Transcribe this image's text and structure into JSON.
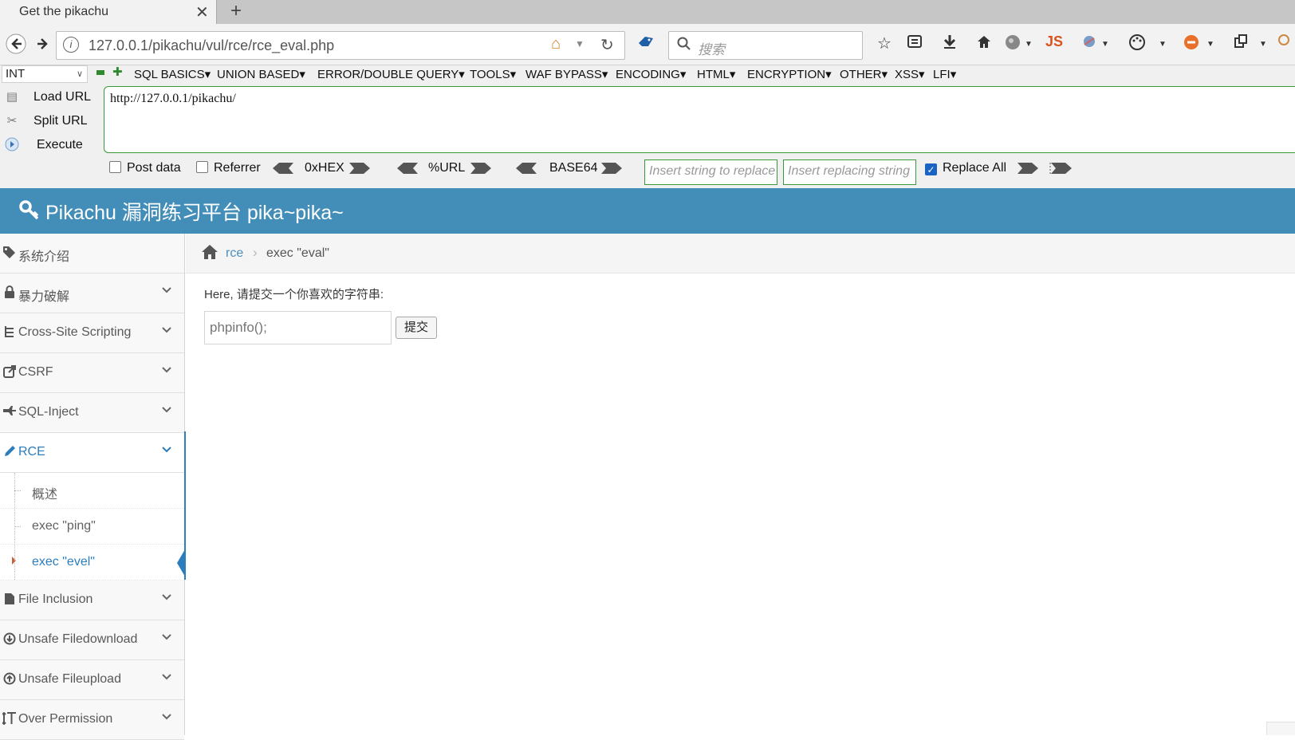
{
  "browser": {
    "tab_title": "Get the pikachu",
    "tab_close": "✕",
    "new_tab": "+",
    "url": "127.0.0.1/pikachu/vul/rce/rce_eval.php",
    "search_placeholder": "搜索"
  },
  "hackbar": {
    "encoding_select": "INT",
    "menus": [
      "SQL BASICS",
      "UNION BASED",
      "ERROR/DOUBLE QUERY",
      "TOOLS",
      "WAF BYPASS",
      "ENCODING",
      "HTML",
      "ENCRYPTION",
      "OTHER",
      "XSS",
      "LFI"
    ],
    "load_url": "Load URL",
    "split_url": "Split URL",
    "execute": "Execute",
    "url_value": "http://127.0.0.1/pikachu/",
    "post_data": "Post data",
    "referrer": "Referrer",
    "hex": "0xHEX",
    "urlenc": "%URL",
    "base64": "BASE64",
    "replace_placeholder": "Insert string to replace",
    "replacing_placeholder": "Insert replacing string",
    "replace_all": "Replace All",
    "replace_all_checked": true
  },
  "app": {
    "brand": "Pikachu 漏洞练习平台 pika~pika~",
    "header_color": "#438eb9",
    "accent_color": "#2b7dbc"
  },
  "sidebar": {
    "items": [
      {
        "label": "系统介绍",
        "icon": "tags-icon"
      },
      {
        "label": "暴力破解",
        "icon": "lock-icon"
      },
      {
        "label": "Cross-Site Scripting",
        "icon": "sitemap-icon"
      },
      {
        "label": "CSRF",
        "icon": "share-square-icon"
      },
      {
        "label": "SQL-Inject",
        "icon": "fighter-jet-icon"
      },
      {
        "label": "RCE",
        "icon": "pencil-icon"
      },
      {
        "label": "File Inclusion",
        "icon": "file-icon"
      },
      {
        "label": "Unsafe Filedownload",
        "icon": "download-circle-icon"
      },
      {
        "label": "Unsafe Fileupload",
        "icon": "upload-circle-icon"
      },
      {
        "label": "Over Permission",
        "icon": "text-height-icon"
      }
    ],
    "rce_sub": [
      "概述",
      "exec \"ping\"",
      "exec \"evel\""
    ]
  },
  "breadcrumb": {
    "link": "rce",
    "separator": "›",
    "current": "exec \"eval\""
  },
  "main": {
    "prompt": "Here, 请提交一个你喜欢的字符串:",
    "input_placeholder": "phpinfo();",
    "submit_label": "提交"
  }
}
